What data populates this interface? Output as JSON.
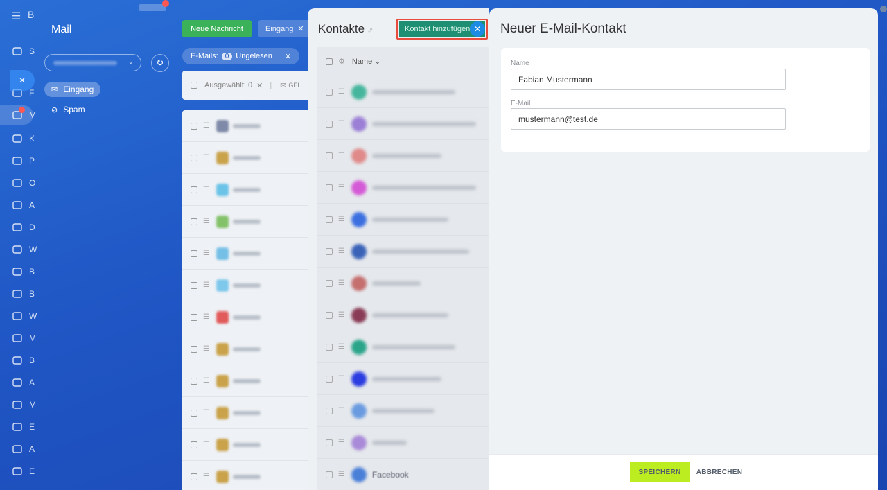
{
  "left_nav": {
    "brand_letter": "B",
    "items": [
      {
        "icon": "home-icon",
        "letter": "S"
      },
      {
        "icon": "feed-icon",
        "letter": "F"
      },
      {
        "icon": "messenger-icon",
        "letter": "M"
      },
      {
        "icon": "calendar-icon",
        "letter": "K"
      },
      {
        "icon": "people-icon",
        "letter": "P"
      },
      {
        "icon": "document-icon",
        "letter": "O"
      },
      {
        "icon": "tasks-icon",
        "letter": "A"
      },
      {
        "icon": "drive-icon",
        "letter": "D"
      },
      {
        "icon": "mail-icon",
        "letter": "W"
      },
      {
        "icon": "sites-icon",
        "letter": "B"
      },
      {
        "icon": "analytics-icon",
        "letter": "B"
      },
      {
        "icon": "cart-icon",
        "letter": "W"
      },
      {
        "icon": "marketing-icon",
        "letter": "M"
      },
      {
        "icon": "booking-icon",
        "letter": "B"
      },
      {
        "icon": "automation-icon",
        "letter": "A"
      },
      {
        "icon": "target-icon",
        "letter": "M"
      },
      {
        "icon": "edit-icon",
        "letter": "E"
      },
      {
        "icon": "apps-icon",
        "letter": "A"
      },
      {
        "icon": "settings-icon",
        "letter": "E"
      }
    ]
  },
  "mail": {
    "title": "Mail",
    "folders": [
      {
        "label": "Eingang",
        "icon": "inbox-icon"
      },
      {
        "label": "Spam",
        "icon": "spam-icon"
      }
    ],
    "new_message": "Neue Nachricht",
    "folder_filter": "Eingang",
    "emails_label": "E-Mails:",
    "unread_count": "0",
    "unread_label": "Ungelesen",
    "selected_label": "Ausgewählt: 0",
    "read_action": "GEL"
  },
  "contacts": {
    "title": "Kontakte",
    "add_button": "Kontakt hinzufügen",
    "name_column": "Name",
    "last_row_text": "Facebook"
  },
  "new_contact": {
    "title": "Neuer E-Mail-Kontakt",
    "name_label": "Name",
    "name_value": "Fabian Mustermann",
    "email_label": "E-Mail",
    "email_value": "mustermann@test.de",
    "save": "SPEICHERN",
    "cancel": "ABBRECHEN"
  },
  "colors": {
    "primary_green": "#3bb25a",
    "add_contact_green": "#1e8f72",
    "highlight_red": "#e84c3d",
    "save_lime": "#bbed21",
    "notification_red": "#ff5752"
  }
}
